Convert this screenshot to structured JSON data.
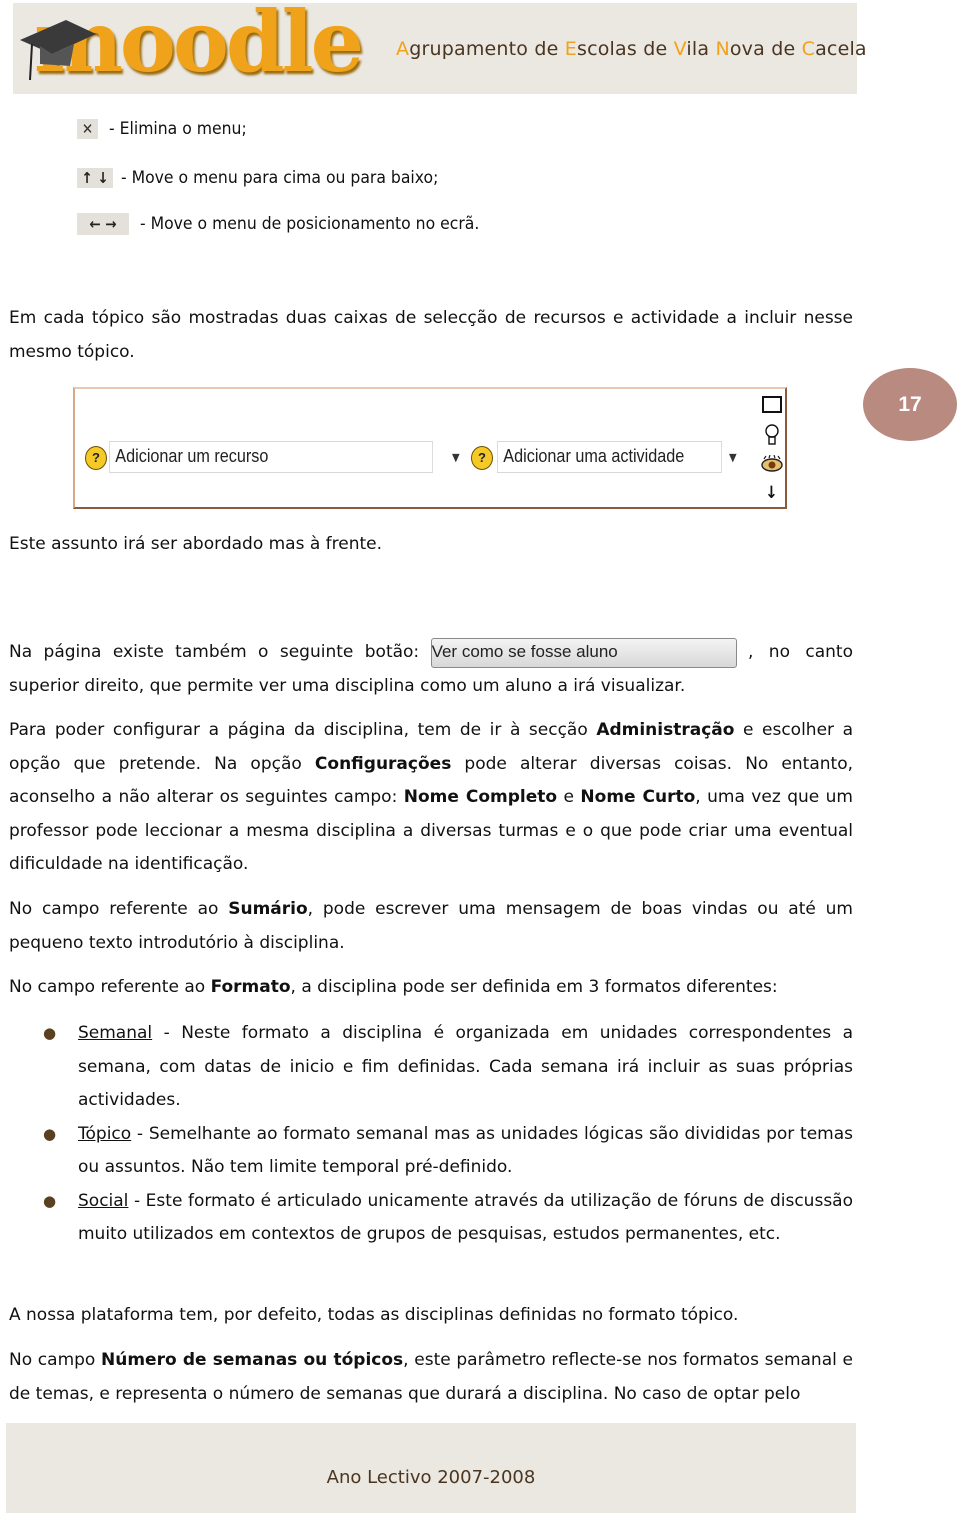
{
  "header": {
    "logo_text": "moodle",
    "school_title_parts": [
      {
        "text": "A",
        "hl": true
      },
      {
        "text": "grupamento de ",
        "hl": false
      },
      {
        "text": "E",
        "hl": true
      },
      {
        "text": "scolas de ",
        "hl": false
      },
      {
        "text": "V",
        "hl": true
      },
      {
        "text": "ila ",
        "hl": false
      },
      {
        "text": "N",
        "hl": true
      },
      {
        "text": "ova de ",
        "hl": false
      },
      {
        "text": "C",
        "hl": true
      },
      {
        "text": "acela",
        "hl": false
      }
    ],
    "colors": {
      "accent": "#f0a21a",
      "text": "#4a3620",
      "band": "#ebe7e1"
    }
  },
  "icon_legend": [
    {
      "icon": "close-icon",
      "glyph": "✕",
      "text": "- Elimina o menu;"
    },
    {
      "icon": "up-down-arrows-icon",
      "glyph": "↑ ↓",
      "text": "- Move o menu para cima ou para baixo;"
    },
    {
      "icon": "left-right-arrows-icon",
      "glyph": "← →",
      "text": "- Move o menu de posicionamento no ecrã."
    }
  ],
  "para_topics": "Em cada tópico são mostradas duas caixas de selecção de recursos e actividade a incluir nesse mesmo tópico.",
  "moodle_box": {
    "select_resource": "Adicionar um recurso",
    "select_activity": "Adicionar uma actividade",
    "help_glyph": "?",
    "side_icons": [
      "square-icon",
      "lightbulb-icon",
      "eye-icon",
      "arrow-down-icon"
    ]
  },
  "page_number": "17",
  "para_later": "Este assunto irá ser abordado mas à frente.",
  "para_button": {
    "before": "Na página existe também o seguinte botão:",
    "button_label": "Ver como se fosse aluno",
    "after_same_line": ", no canto",
    "second_line": "superior direito, que permite ver uma disciplina como um aluno a irá visualizar."
  },
  "para_admin": {
    "t1": "Para poder configurar a página da disciplina, tem de ir à secção ",
    "b1": "Administração",
    "t2": " e escolher a opção que pretende. Na opção ",
    "b2": "Configurações",
    "t3": " pode alterar diversas coisas. No entanto, aconselho a não alterar os seguintes campo: ",
    "b3": "Nome Completo",
    "t4": " e ",
    "b4": "Nome Curto",
    "t5": ", uma vez que um professor pode leccionar a mesma disciplina a diversas turmas e o que pode criar uma eventual dificuldade na identificação."
  },
  "para_sumario": {
    "t1": "No campo referente ao ",
    "b1": "Sumário",
    "t2": ", pode escrever uma mensagem de boas vindas ou até um pequeno texto introdutório à disciplina."
  },
  "para_formato": {
    "t1": "No campo referente ao ",
    "b1": "Formato",
    "t2": ", a disciplina pode ser definida em 3 formatos diferentes:"
  },
  "formats": [
    {
      "name": "Semanal",
      "desc": " - Neste formato a disciplina é organizada em unidades correspondentes a semana, com datas de inicio e fim definidas. Cada semana irá incluir as suas próprias actividades."
    },
    {
      "name": "Tópico",
      "desc": " - Semelhante ao formato semanal mas as unidades lógicas são divididas por temas ou assuntos. Não tem limite temporal pré-definido."
    },
    {
      "name": "Social",
      "desc": " - Este formato é articulado unicamente através da utilização de fóruns de discussão muito utilizados em contextos de grupos de pesquisas, estudos permanentes, etc."
    }
  ],
  "para_default": "A nossa plataforma tem, por defeito, todas as disciplinas definidas no formato tópico.",
  "para_numero": {
    "t1": "No campo ",
    "b1": "Número de semanas ou tópicos",
    "t2": ", este parâmetro reflecte-se nos formatos semanal e de temas, e representa o número de semanas que durará a disciplina. No caso de optar pelo"
  },
  "footer": {
    "text": "Ano Lectivo 2007-2008"
  }
}
